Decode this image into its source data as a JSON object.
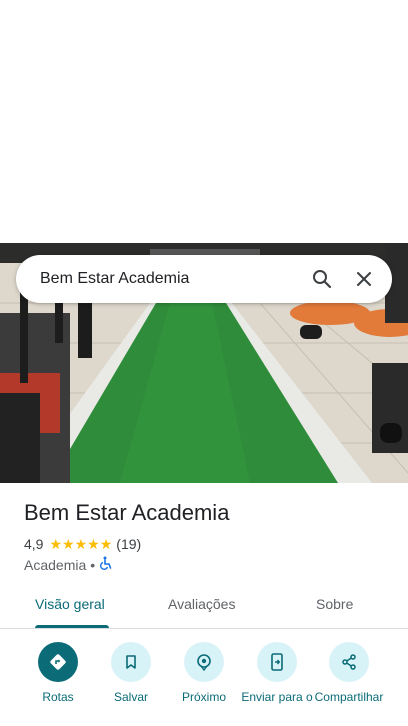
{
  "search": {
    "query": "Bem Estar Academia"
  },
  "place": {
    "name": "Bem Estar Academia",
    "rating": "4,9",
    "stars_filled": 5,
    "review_count": "(19)",
    "category": "Academia",
    "separator": "•"
  },
  "tabs": [
    {
      "label": "Visão geral",
      "active": true
    },
    {
      "label": "Avaliações",
      "active": false
    },
    {
      "label": "Sobre",
      "active": false
    }
  ],
  "actions": [
    {
      "label": "Rotas",
      "icon": "directions-icon"
    },
    {
      "label": "Salvar",
      "icon": "bookmark-icon"
    },
    {
      "label": "Próximo",
      "icon": "nearby-icon"
    },
    {
      "label": "Enviar para o",
      "icon": "send-to-phone-icon"
    },
    {
      "label": "Compartilhar",
      "icon": "share-icon"
    }
  ],
  "colors": {
    "accent": "#0b6b77",
    "chip": "#d7f3f8",
    "star": "#fbbc04",
    "accessibility": "#1a73e8"
  }
}
